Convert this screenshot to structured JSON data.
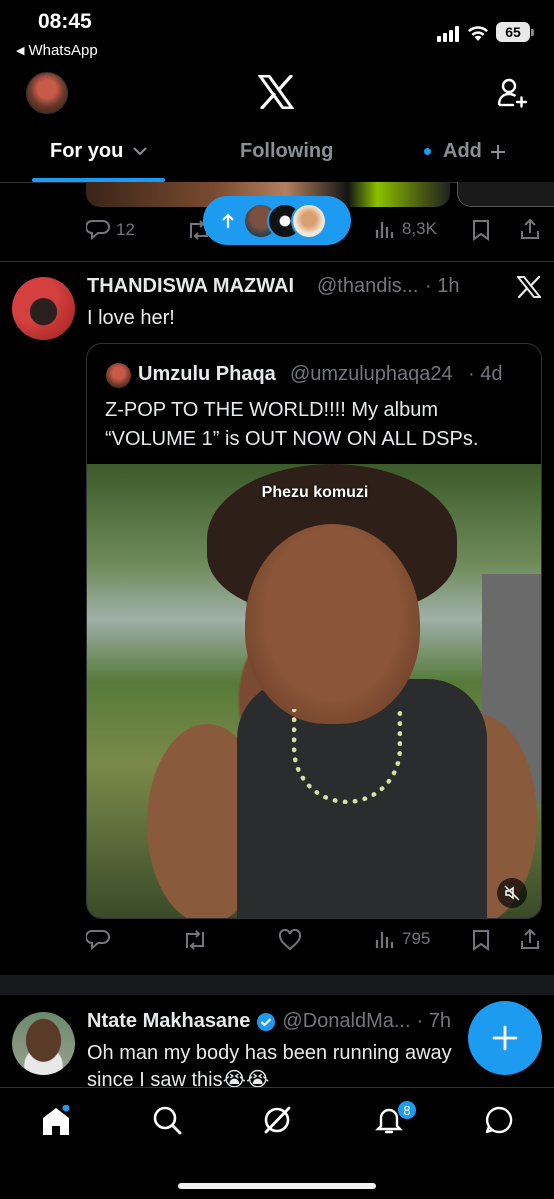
{
  "status_bar": {
    "time": "08:45",
    "back_app": "WhatsApp",
    "back_arrow": "◀",
    "battery": "65"
  },
  "header": {
    "logo_icon": "x-logo-icon",
    "add_user_icon": "add-user-icon"
  },
  "tabs": [
    {
      "label": "For you",
      "active": true
    },
    {
      "label": "Following",
      "active": false
    },
    {
      "label": "Add",
      "active": false
    }
  ],
  "previous_post": {
    "replies": "12",
    "views": "8,3K"
  },
  "posts": [
    {
      "name": "THANDISWA MAZWAI",
      "handle": "@thandis...",
      "time": "· 1h",
      "text": "I love her!",
      "quote": {
        "name": "Umzulu Phaqa",
        "handle": "@umzuluphaqa24",
        "time": "· 4d",
        "text_line1": "Z-POP TO THE WORLD!!!! My album",
        "text_line2": "“VOLUME 1” is OUT NOW ON ALL DSPs.",
        "media_caption": "Phezu komuzi"
      },
      "views": "795"
    },
    {
      "name": "Ntate Makhasane",
      "verified": true,
      "handle": "@DonaldMa...",
      "time": "· 7h",
      "text_line1": "Oh man my body has been running away",
      "text_line2": "since I saw this😭😭"
    }
  ],
  "bottom_nav": {
    "notifications_badge": "8"
  },
  "colors": {
    "accent": "#1d9bf0",
    "muted": "#71767b",
    "background": "#000000"
  }
}
